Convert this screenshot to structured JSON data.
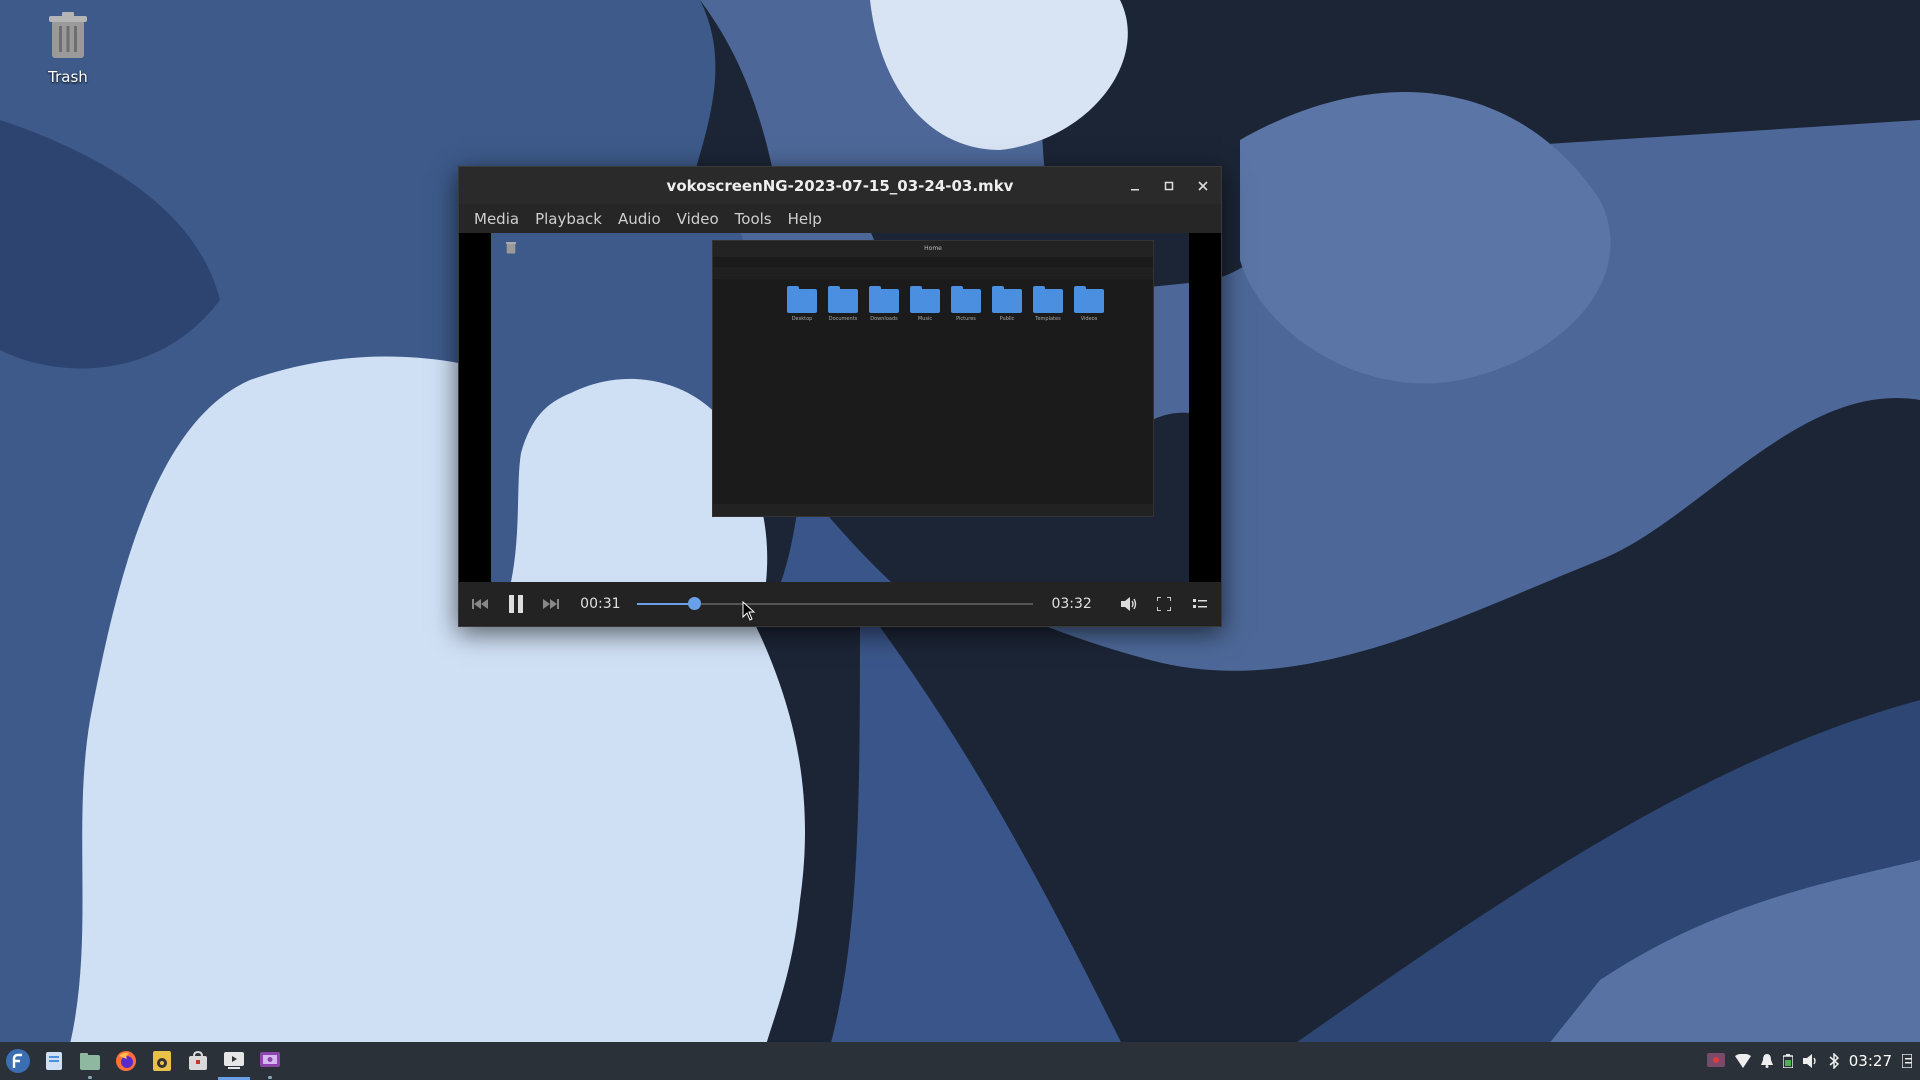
{
  "desktop": {
    "trash_label": "Trash"
  },
  "player": {
    "title": "vokoscreenNG-2023-07-15_03-24-03.mkv",
    "menu": [
      "Media",
      "Playback",
      "Audio",
      "Video",
      "Tools",
      "Help"
    ],
    "elapsed": "00:31",
    "duration": "03:32",
    "progress": 0.146,
    "accent_color": "#6aa0e8"
  },
  "nested_file_manager": {
    "title": "Home",
    "folders": [
      "Desktop",
      "Documents",
      "Downloads",
      "Music",
      "Pictures",
      "Public",
      "Templates",
      "Videos"
    ]
  },
  "taskbar": {
    "apps": [
      "fedora-menu-icon",
      "files-icon",
      "file-manager-icon",
      "firefox-icon",
      "rhythmbox-icon",
      "software-icon",
      "media-player-icon",
      "screen-recorder-icon"
    ],
    "clock": "03:27"
  }
}
